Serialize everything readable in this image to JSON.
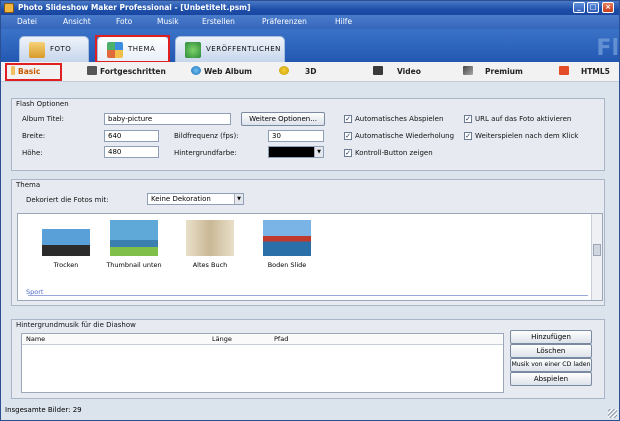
{
  "window": {
    "title": "Photo Slideshow Maker Professional - [Unbetitelt.psm]",
    "minimize": "_",
    "maximize": "□",
    "close": "×"
  },
  "menu": [
    "Datei",
    "Ansicht",
    "Foto",
    "Musik",
    "Erstellen",
    "Präferenzen",
    "Hilfe"
  ],
  "main_tabs": [
    {
      "label": "FOTO",
      "icon": "photo-tab-icon"
    },
    {
      "label": "THEMA",
      "icon": "theme-tab-icon"
    },
    {
      "label": "VERÖFFENTLICHEN",
      "icon": "publish-tab-icon"
    }
  ],
  "brand_watermark": "Fl",
  "sub_tabs": [
    {
      "label": "Basic",
      "icon": "basic-icon"
    },
    {
      "label": "Fortgeschritten",
      "icon": "camera-icon"
    },
    {
      "label": "Web Album",
      "icon": "globe-icon"
    },
    {
      "label": "3D",
      "icon": "3d-icon"
    },
    {
      "label": "Video",
      "icon": "film-icon"
    },
    {
      "label": "Premium",
      "icon": "premium-icon"
    },
    {
      "label": "HTML5",
      "icon": "html5-icon"
    }
  ],
  "flash": {
    "title": "Flash Optionen",
    "album_title_label": "Album Titel:",
    "album_title_value": "baby-picture",
    "width_label": "Breite:",
    "width_value": "640",
    "height_label": "Höhe:",
    "height_value": "480",
    "fps_label": "Bildfrequenz (fps):",
    "fps_value": "30",
    "bg_color_label": "Hintergrundfarbe:",
    "more_options_button": "Weitere Optionen...",
    "auto_play": "Automatisches Abspielen",
    "auto_repeat": "Automatische Wiederholung",
    "show_control": "Kontroll-Button zeigen",
    "url_on_photo": "URL auf das Foto aktivieren",
    "continue_after_click": "Weiterspielen nach dem Klick"
  },
  "theme": {
    "title": "Thema",
    "decorate_label": "Dekoriert die Fotos mit:",
    "decorate_value": "Keine Dekoration",
    "items": [
      "Trocken",
      "Thumbnail unten",
      "Altes Buch",
      "Boden Slide"
    ],
    "category": "Sport"
  },
  "music": {
    "title": "Hintergrundmusik für die Diashow",
    "columns": [
      "Name",
      "Länge",
      "Pfad"
    ],
    "buttons": [
      "Hinzufügen",
      "Löschen",
      "Musik von einer CD laden",
      "Abspielen"
    ]
  },
  "status": "Insgesamte Bilder: 29",
  "colors": {
    "titlebar": "#1c4ea8",
    "highlight": "#e02020",
    "bg_swatch": "#000000"
  }
}
